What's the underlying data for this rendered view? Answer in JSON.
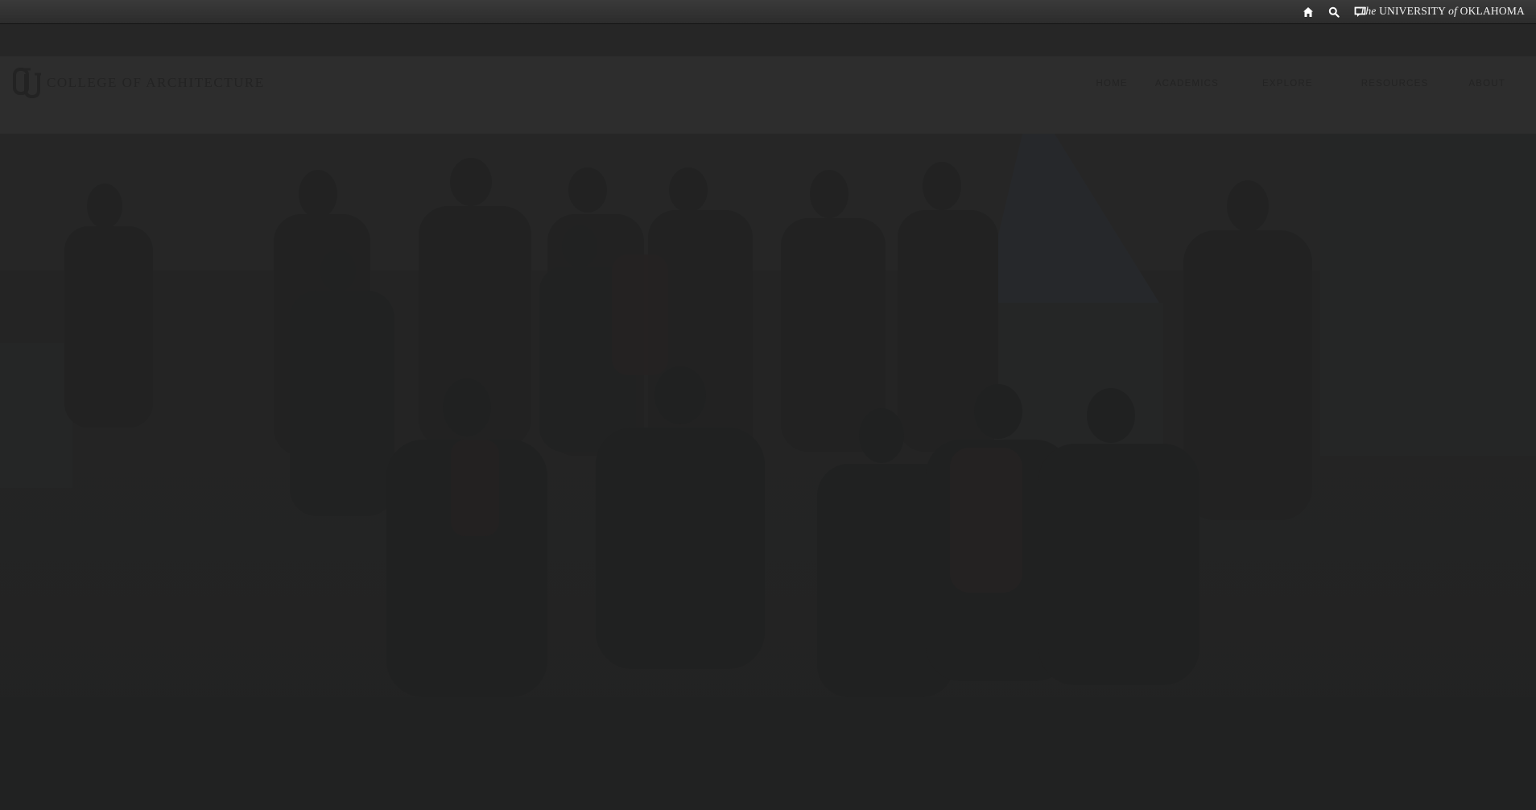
{
  "utility_bar": {
    "icons": [
      "home-icon",
      "search-icon",
      "chat-icon"
    ],
    "brand": {
      "the": "The",
      "university": "UNIVERSITY",
      "of": "of",
      "state": "OKLAHOMA"
    }
  },
  "header": {
    "site_title": "COLLEGE OF ARCHITECTURE",
    "nav": [
      "HOME",
      "ACADEMICS",
      "EXPLORE",
      "RESOURCES",
      "ABOUT"
    ]
  },
  "hero": {
    "image_description_icon": "group-photo"
  },
  "colors": {
    "topbar": "#333333",
    "header": "#2d2d2d",
    "hero": "#262727",
    "brand_text": "#f2f2f2"
  }
}
